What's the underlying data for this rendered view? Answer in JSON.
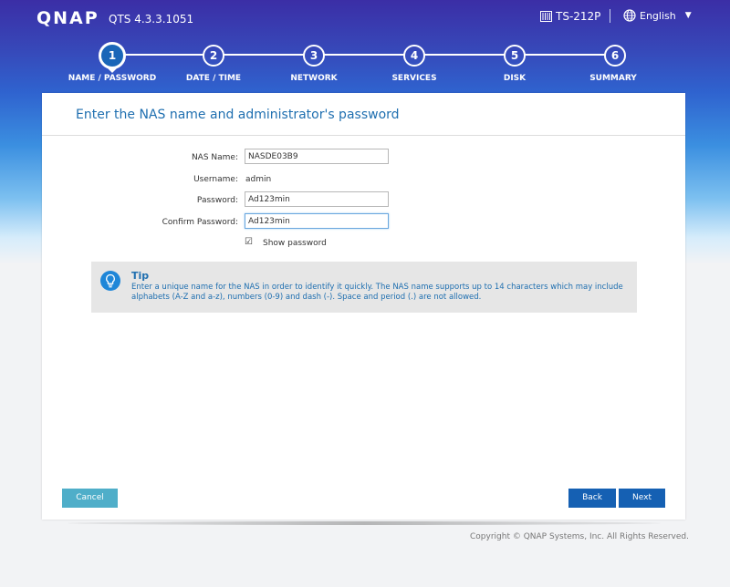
{
  "header": {
    "logo": "QNAP",
    "version": "QTS 4.3.3.1051",
    "model": "TS-212P",
    "language": "English"
  },
  "steps": [
    {
      "number": "1",
      "label": "NAME / PASSWORD",
      "active": true
    },
    {
      "number": "2",
      "label": "DATE / TIME",
      "active": false
    },
    {
      "number": "3",
      "label": "NETWORK",
      "active": false
    },
    {
      "number": "4",
      "label": "SERVICES",
      "active": false
    },
    {
      "number": "5",
      "label": "DISK",
      "active": false
    },
    {
      "number": "6",
      "label": "SUMMARY",
      "active": false
    }
  ],
  "panel": {
    "title": "Enter the NAS name and administrator's password"
  },
  "form": {
    "nas_name_label": "NAS Name:",
    "nas_name_value": "NASDE03B9",
    "username_label": "Username:",
    "username_value": "admin",
    "password_label": "Password:",
    "password_value": "Ad123min",
    "confirm_label": "Confirm Password:",
    "confirm_value": "Ad123min",
    "show_password_label": "Show password",
    "show_password_checked": true
  },
  "tip": {
    "title": "Tip",
    "text": "Enter a unique name for the NAS in order to identify it quickly. The NAS name supports up to 14 characters which may include alphabets (A-Z and a-z), numbers (0-9) and dash (-). Space and period (.) are not allowed."
  },
  "buttons": {
    "cancel": "Cancel",
    "back": "Back",
    "next": "Next"
  },
  "footer": {
    "copyright": "Copyright © QNAP Systems, Inc. All Rights Reserved."
  },
  "colors": {
    "accent": "#1f6fb0",
    "button_primary": "#1560b3",
    "button_cancel": "#4faec9"
  },
  "icons": {
    "model": "server-icon",
    "language": "globe-icon",
    "tip": "lightbulb-icon"
  }
}
